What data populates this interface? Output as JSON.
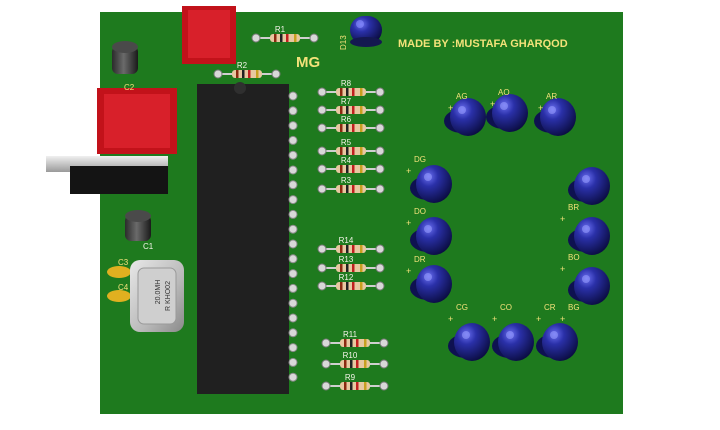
{
  "board": {
    "credit": "MADE BY :MUSTAFA GHARQOD",
    "logo": "MG",
    "board_color": "#1e7a1e",
    "led_color": "#1a1f7a",
    "resistor_labels": [
      "R1",
      "R2",
      "R8",
      "R7",
      "R6",
      "R5",
      "R4",
      "R3",
      "R14",
      "R13",
      "R12",
      "R11",
      "R10",
      "R9"
    ],
    "led_labels": [
      "D13",
      "AG",
      "AO",
      "AR",
      "DG",
      "DO",
      "DR",
      "BR",
      "BO",
      "BG",
      "CG",
      "CO",
      "CR"
    ],
    "cap_labels": [
      "C2",
      "C1",
      "C3",
      "C4"
    ],
    "crystal": {
      "line1": "20.0MH",
      "line2": "R KHO02"
    }
  }
}
